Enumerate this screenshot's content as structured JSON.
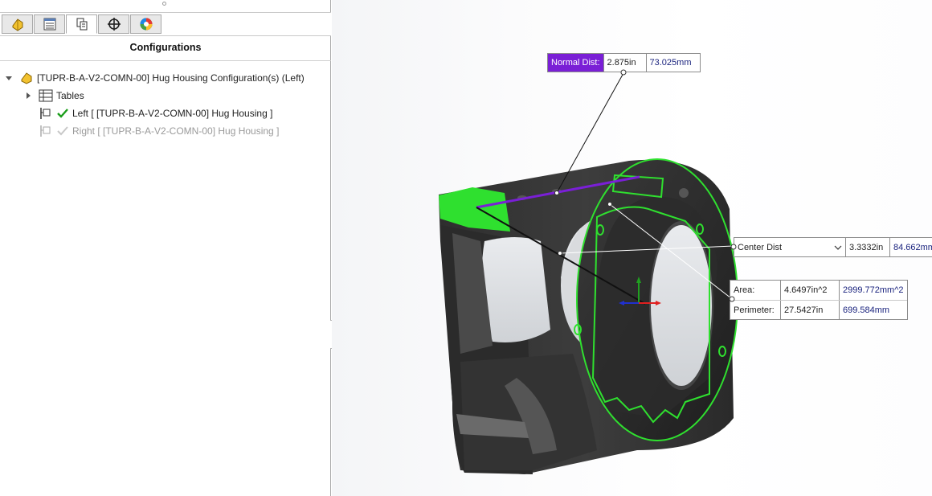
{
  "panel": {
    "tabs": [
      {
        "name": "feature-manager",
        "icon": "part-icon"
      },
      {
        "name": "property-manager",
        "icon": "property-list-icon"
      },
      {
        "name": "configuration-manager",
        "icon": "configuration-icon"
      },
      {
        "name": "dimxpert-manager",
        "icon": "crosshair-icon"
      },
      {
        "name": "display-manager",
        "icon": "appearance-icon"
      }
    ],
    "title": "Configurations",
    "tree": {
      "root": "[TUPR-B-A-V2-COMN-00] Hug Housing Configuration(s)  (Left)",
      "tables": "Tables",
      "configs": [
        {
          "label": "Left [ [TUPR-B-A-V2-COMN-00] Hug Housing ]",
          "active": true
        },
        {
          "label": "Right [ [TUPR-B-A-V2-COMN-00] Hug Housing ]",
          "active": false
        }
      ]
    }
  },
  "measure": {
    "normal_dist": {
      "label": "Normal Dist:",
      "in": "2.875in",
      "mm": "73.025mm"
    },
    "center_dist": {
      "label": "Center Dist",
      "in": "3.3332in",
      "mm": "84.662mm"
    },
    "area": {
      "label": "Area:",
      "in": "4.6497in^2",
      "mm": "2999.772mm^2"
    },
    "perimeter": {
      "label": "Perimeter:",
      "in": "27.5427in",
      "mm": "699.584mm"
    }
  },
  "colors": {
    "selection_green": "#2fe02f",
    "normal_dist_bg": "#7a1fd6",
    "model_dark": "#3a3a3a",
    "triad_x": "#e02020",
    "triad_y": "#20a020",
    "triad_z": "#2030d0"
  }
}
